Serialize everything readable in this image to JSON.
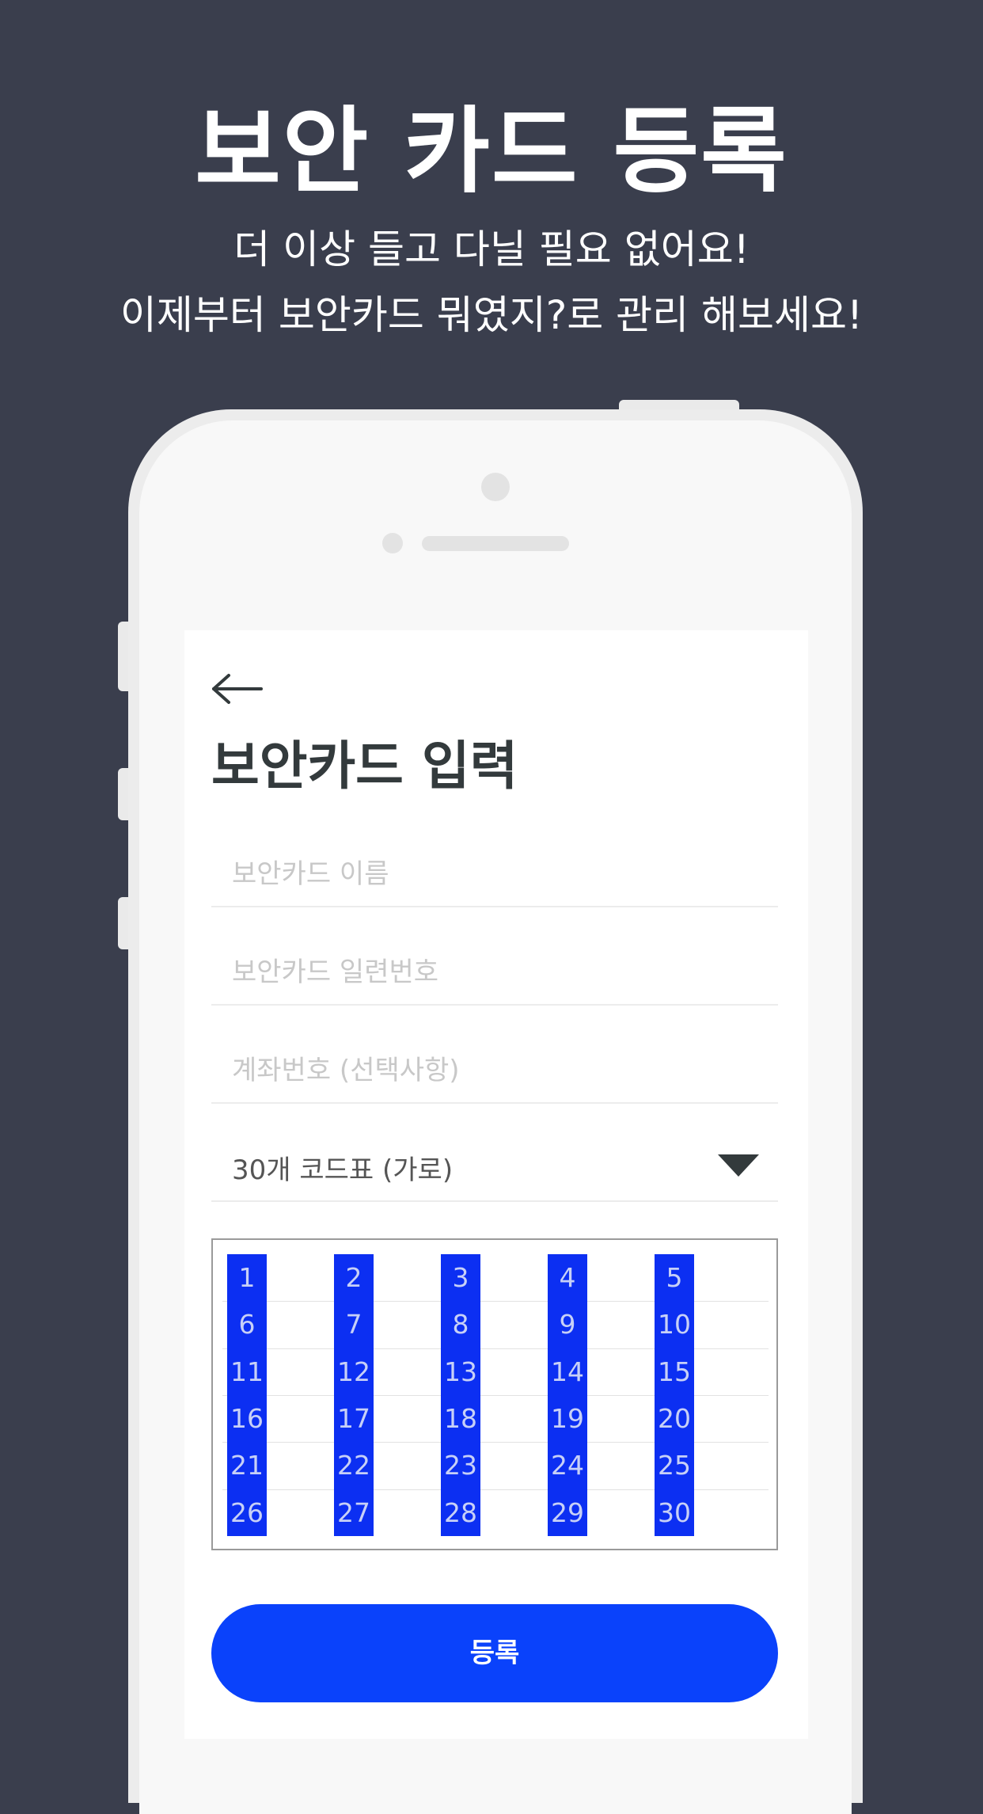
{
  "promo": {
    "title": "보안 카드 등록",
    "subtitle_line1": "더 이상 들고 다닐 필요 없어요!",
    "subtitle_line2": "이제부터 보안카드 뭐였지?로 관리 해보세요!"
  },
  "screen": {
    "back_icon": "back-arrow-icon",
    "title": "보안카드 입력",
    "fields": {
      "card_name_placeholder": "보안카드 이름",
      "card_serial_placeholder": "보안카드 일련번호",
      "account_placeholder": "계좌번호 (선택사항)"
    },
    "code_type_select": {
      "selected": "30개 코드표 (가로)",
      "icon": "dropdown-triangle-icon"
    },
    "code_grid": {
      "rows": [
        [
          "1",
          "2",
          "3",
          "4",
          "5"
        ],
        [
          "6",
          "7",
          "8",
          "9",
          "10"
        ],
        [
          "11",
          "12",
          "13",
          "14",
          "15"
        ],
        [
          "16",
          "17",
          "18",
          "19",
          "20"
        ],
        [
          "21",
          "22",
          "23",
          "24",
          "25"
        ],
        [
          "26",
          "27",
          "28",
          "29",
          "30"
        ]
      ],
      "highlight_color": "#0c2ff2"
    },
    "submit_label": "등록"
  },
  "colors": {
    "background": "#3a3e4d",
    "accent": "#0a42fb",
    "title_text": "#333a3c"
  }
}
